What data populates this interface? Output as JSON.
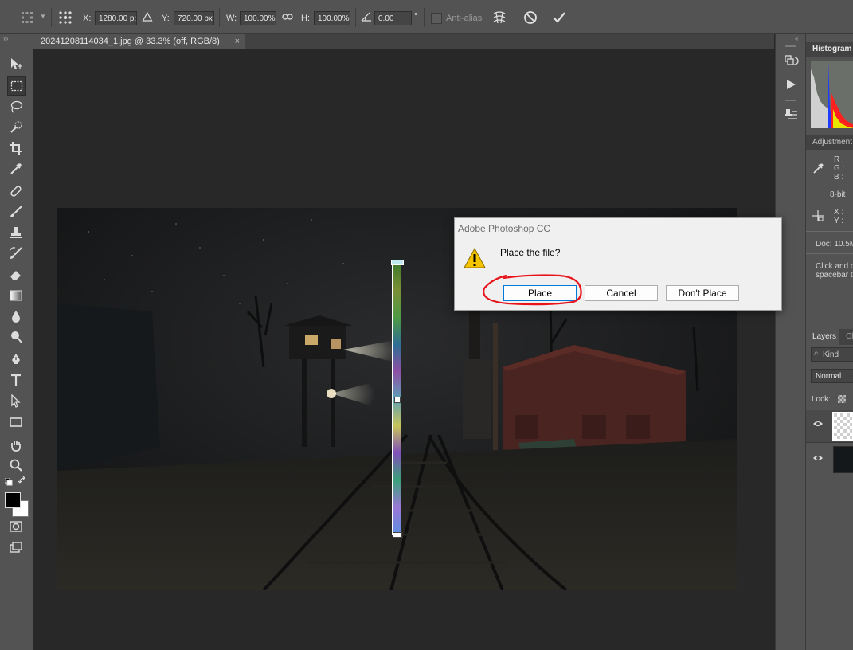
{
  "options_bar": {
    "x_label": "X:",
    "x_value": "1280.00 p:",
    "y_label": "Y:",
    "y_value": "720.00 px",
    "w_label": "W:",
    "w_value": "100.00%",
    "h_label": "H:",
    "h_value": "100.00%",
    "angle_value": "0.00",
    "angle_unit": "°",
    "antialias_label": "Anti-alias"
  },
  "document_tab": {
    "title": "20241208114034_1.jpg @ 33.3% (off, RGB/8)",
    "close": "×"
  },
  "dialog": {
    "title": "Adobe Photoshop CC",
    "message": "Place the file?",
    "buttons": {
      "place": "Place",
      "cancel": "Cancel",
      "dont_place": "Don't Place"
    }
  },
  "right_panel": {
    "histogram_title": "Histogram",
    "adjustments_title": "Adjustment",
    "info": {
      "r": "R :",
      "g": "G :",
      "b": "B :",
      "bit": "8-bit",
      "x": "X :",
      "y": "Y :",
      "doc": "Doc: 10.5M",
      "hint_line1": "Click and d",
      "hint_line2": "spacebar t"
    },
    "layers_tab": "Layers",
    "channels_tab": "Cl",
    "kind_filter": "Kind",
    "blend_mode": "Normal",
    "lock_label": "Lock:"
  },
  "annotations": {
    "arrow_color": "#e8141c",
    "circle_color": "#e8141c"
  },
  "colors": {
    "foreground": "#000000",
    "background": "#ffffff"
  }
}
